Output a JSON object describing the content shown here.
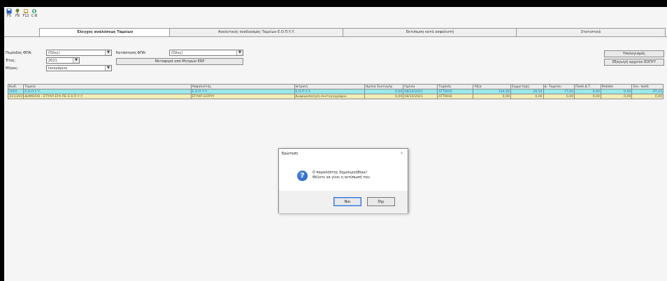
{
  "toolbar": [
    {
      "label": "F5",
      "icon": "save-icon"
    },
    {
      "label": "F8",
      "icon": "tools-icon"
    },
    {
      "label": "F12",
      "icon": "help-icon"
    },
    {
      "label": "C-B",
      "icon": "print-icon"
    }
  ],
  "tabs": [
    {
      "label": "Έλεγχος αναλύσεως Ταμείων",
      "active": true
    },
    {
      "label": "Αναλυτικός συνδυασμός Ταμείων Ε.Ο.Π.Υ.Υ.",
      "active": false
    },
    {
      "label": "Εκτύπωση κατά ασφαλιστή",
      "active": false
    },
    {
      "label": "Στατιστικά",
      "active": false
    }
  ],
  "filters": {
    "period_label": "Περίοδος ΦΠΑ:",
    "period_value": "(Όλες)",
    "year_label": "Έτος:",
    "year_value": "2021",
    "month_label": "Μήνας:",
    "month_value": "Ιανουάριος",
    "vat_label": "Κατάσταση ΦΠΑ:",
    "vat_value": "(Όλες)",
    "erp_button": "Μεταφορά από Μητρώο ERP"
  },
  "right_buttons": {
    "top": "Υπολογισμός",
    "bottom": "Εξαγωγή αρχείου ΕΟΠΥΥ"
  },
  "table": {
    "columns": [
      "Κωδ.",
      "Ταμείο",
      "Ασφαλιστής",
      "Ιατρική",
      "Ημ/νία Συνταγής",
      "Ημ/νία",
      "Ταχ/κός",
      "Αξία",
      "Συμμετοχή",
      "Δ. Ταμείου",
      "Ποσό Δ.Τ.",
      "Rebate",
      "Σύν. ποσό"
    ],
    "rows": [
      [
        "1001",
        "Ε.Ο.Π.Υ.Υ.",
        "Ε.Ο.Π.Υ.Υ.",
        "Ε.Ο.Π.Υ.Υ.",
        "0,00",
        "08/10/2021",
        "ΑΤΤΙΚΗΣ",
        "104,18",
        "26,54",
        "77,64",
        "0,00",
        "0,00",
        "97,43"
      ],
      [
        "311/2019",
        "ΔΗΜΟΣΙΟ - ΕΤΥΑΠ ΕΥΑ ΠΕ Ε.Ο.Π.Υ.Υ.",
        "ΕΤΥΑΠ ΕΟΠΥΥ",
        "Διαφοροποίηση συνταγογράφου",
        "0,00",
        "08/10/2021",
        "ΑΤΤΙΚΗΣ",
        "0,00",
        "0,00",
        "0,00",
        "0,00",
        "0,00",
        "0,00"
      ]
    ]
  },
  "dialog": {
    "title": "Ερώτηση",
    "close": "×",
    "message_line1": "Ο παραλήπτης δημιουργήθηκε!",
    "message_line2": "Θέλετε να γίνει η εκτύπωσή του;",
    "yes": "Ναι",
    "no": "Όχι"
  }
}
